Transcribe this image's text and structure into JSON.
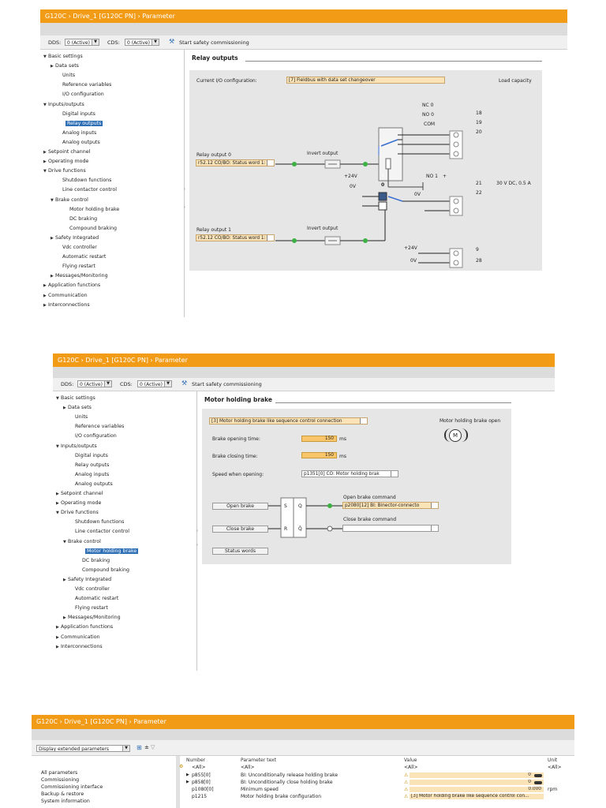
{
  "panel1": {
    "breadcrumb": [
      "G120C",
      "Drive_1 [G120C PN]",
      "Parameter"
    ],
    "dds_label": "DDS:",
    "dds_value": "0 (Active)",
    "cds_label": "CDS:",
    "cds_value": "0 (Active)",
    "safety_button": "Start safety commissioning",
    "section_title": "Relay outputs",
    "current_io_label": "Current I/O configuration:",
    "current_io_value": "[7] Fieldbus with data set changeover",
    "load_capacity_label": "Load capacity",
    "relay0_label": "Relay output 0",
    "relay0_source": "r52.12 CO/BO: Status word 1: f",
    "relay1_label": "Relay output 1",
    "relay1_source": "r52.12 CO/BO: Status word 1: f",
    "invert_output_1": "Invert output",
    "invert_output_2": "Invert output",
    "nc0": "NC 0",
    "no0": "NO 0",
    "com": "COM",
    "t18": "18",
    "t19": "19",
    "t20": "20",
    "plus24v_a": "+24V",
    "zero_v_a": "0V",
    "b1": "1",
    "b0": "0",
    "no1": "NO 1",
    "plus": "+",
    "zero_v_b": "0V",
    "t21": "21",
    "t22": "22",
    "rating": "30 V DC, 0.5 A",
    "plus24v_b": "+24V",
    "zero_v_c": "0V",
    "t9": "9",
    "t28": "28"
  },
  "panel2": {
    "breadcrumb": [
      "G120C",
      "Drive_1 [G120C PN]",
      "Parameter"
    ],
    "dds_label": "DDS:",
    "dds_value": "0 (Active)",
    "cds_label": "CDS:",
    "cds_value": "0 (Active)",
    "safety_button": "Start safety commissioning",
    "section_title": "Motor holding brake",
    "config_value": "[3] Motor holding brake like sequence control connection",
    "brake_open_status": "Motor holding brake open",
    "motor_symbol": "M",
    "opening_time_label": "Brake opening time:",
    "opening_time_value": "150",
    "opening_time_unit": "ms",
    "closing_time_label": "Brake closing time:",
    "closing_time_value": "150",
    "closing_time_unit": "ms",
    "speed_label": "Speed when opening:",
    "speed_value": "p1351[0] CO: Motor holding brak",
    "open_brake_button": "Open brake",
    "close_brake_button": "Close brake",
    "status_words_button": "Status words",
    "ff_s": "S",
    "ff_r": "R",
    "ff_q": "Q",
    "ff_qbar": "Q̄",
    "open_cmd_label": "Open brake command",
    "open_cmd_value": "p2080[12] BI: Binector-connecto",
    "close_cmd_label": "Close brake command",
    "close_cmd_value": ""
  },
  "nav_items": [
    {
      "label": "Basic settings",
      "tri": "▼",
      "indent": 0
    },
    {
      "label": "Data sets",
      "tri": "▶",
      "indent": 1
    },
    {
      "label": "Units",
      "tri": "",
      "indent": 2
    },
    {
      "label": "Reference variables",
      "tri": "",
      "indent": 2
    },
    {
      "label": "I/O configuration",
      "tri": "",
      "indent": 2
    },
    {
      "label": "Inputs/outputs",
      "tri": "▼",
      "indent": 0
    },
    {
      "label": "Digital inputs",
      "tri": "",
      "indent": 2
    },
    {
      "label": "Relay outputs",
      "tri": "",
      "indent": 2
    },
    {
      "label": "Analog inputs",
      "tri": "",
      "indent": 2
    },
    {
      "label": "Analog outputs",
      "tri": "",
      "indent": 2
    },
    {
      "label": "Setpoint channel",
      "tri": "▶",
      "indent": 0
    },
    {
      "label": "Operating mode",
      "tri": "▶",
      "indent": 0
    },
    {
      "label": "Drive functions",
      "tri": "▼",
      "indent": 0
    },
    {
      "label": "Shutdown functions",
      "tri": "",
      "indent": 2
    },
    {
      "label": "Line contactor control",
      "tri": "",
      "indent": 2
    },
    {
      "label": "Brake control",
      "tri": "▼",
      "indent": 1
    },
    {
      "label": "Motor holding brake",
      "tri": "",
      "indent": 3
    },
    {
      "label": "DC braking",
      "tri": "",
      "indent": 3
    },
    {
      "label": "Compound braking",
      "tri": "",
      "indent": 3
    },
    {
      "label": "Safety Integrated",
      "tri": "▶",
      "indent": 1
    },
    {
      "label": "Vdc controller",
      "tri": "",
      "indent": 2
    },
    {
      "label": "Automatic restart",
      "tri": "",
      "indent": 2
    },
    {
      "label": "Flying restart",
      "tri": "",
      "indent": 2
    },
    {
      "label": "Messages/Monitoring",
      "tri": "▶",
      "indent": 1
    },
    {
      "label": "Application functions",
      "tri": "▶",
      "indent": 0
    },
    {
      "label": "Communication",
      "tri": "▶",
      "indent": 0
    },
    {
      "label": "Interconnections",
      "tri": "▶",
      "indent": 0
    }
  ],
  "panel3": {
    "breadcrumb": [
      "G120C",
      "Drive_1 [G120C PN]",
      "Parameter"
    ],
    "display_select": "Display extended parameters",
    "nav": [
      "All parameters",
      "Commissioning",
      "Commissioning interface",
      "Backup & restore",
      "System information"
    ],
    "columns": {
      "number": "Number",
      "text": "Parameter text",
      "value": "Value",
      "unit": "Unit"
    },
    "filter": {
      "number": "<All>",
      "text": "<All>",
      "value": "<All>",
      "unit": "<All>"
    },
    "rows": [
      {
        "number": "p855[0]",
        "text": "BI: Unconditionally release holding brake",
        "value": "0",
        "unit": "",
        "expand": "▶"
      },
      {
        "number": "p858[0]",
        "text": "BI: Unconditionally close holding brake",
        "value": "0",
        "unit": "",
        "expand": "▶"
      },
      {
        "number": "p1080[0]",
        "text": "Minimum speed",
        "value": "0.000",
        "unit": "rpm",
        "expand": ""
      },
      {
        "number": "p1215",
        "text": "Motor holding brake configuration",
        "value": "[3] Motor holding brake like sequence control con...",
        "unit": "",
        "expand": ""
      }
    ]
  },
  "colors": {
    "accent": "#f29b17",
    "selection": "#2f6fb5",
    "field": "#fbe3b8",
    "numeric": "#f9c56b",
    "signal": "#3cb043"
  }
}
